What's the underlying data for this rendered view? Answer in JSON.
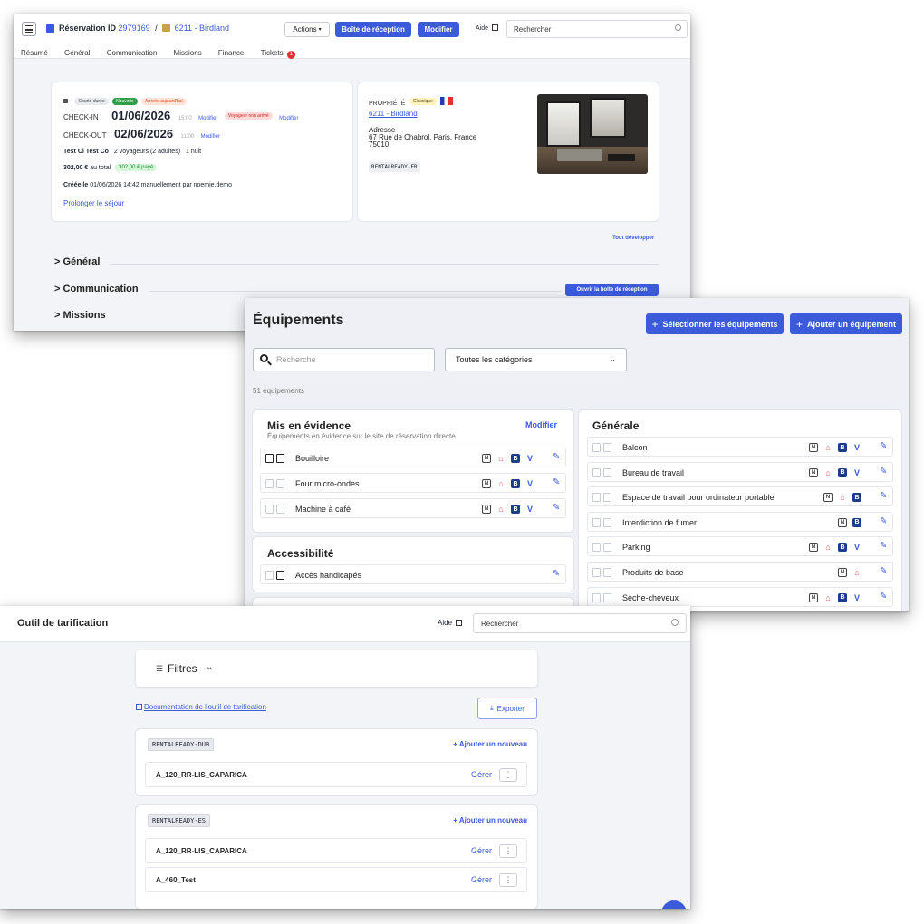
{
  "reservation": {
    "header": {
      "id_label": "Réservation ID",
      "id_value": "2979169",
      "separator": "/",
      "property_name": "6211 - Birdland",
      "actions_label": "Actions",
      "inbox_label": "Boîte de réception",
      "modify_label": "Modifier",
      "help_label": "Aide",
      "search_placeholder": "Rechercher"
    },
    "tabs": [
      {
        "label": "Résumé"
      },
      {
        "label": "Général"
      },
      {
        "label": "Communication"
      },
      {
        "label": "Missions"
      },
      {
        "label": "Finance"
      },
      {
        "label": "Tickets",
        "badge": "1"
      }
    ],
    "summary": {
      "badge_short": "Courte durée",
      "badge_new": "Nouvelle",
      "badge_arrival": "Arrivée aujourd'hui",
      "checkin_label": "CHECK-IN",
      "checkin_date": "01/06/2026",
      "checkin_time": "15:00",
      "modify_link": "Modifier",
      "guest_status": "Voyageur non arrivé",
      "checkout_label": "CHECK-OUT",
      "checkout_date": "02/06/2026",
      "checkout_time": "11:00",
      "guest_name": "Test Ci Test Co",
      "guests": "2 voyageurs (2 adultes)",
      "nights": "1 nuit",
      "total": "302,00 €",
      "total_suffix": "au total",
      "paid": "302,00 € payé",
      "created_label": "Créée le",
      "created_text": "01/06/2026 14:42 manuellement par noemie.demo",
      "extend_link": "Prolonger le séjour"
    },
    "property": {
      "label": "PROPRIÉTÉ",
      "badge": "Classique",
      "name": "6211 - Birdland",
      "address_label": "Adresse",
      "address_line1": "67 Rue de Chabrol, Paris, France",
      "address_line2": "75010",
      "tag": "RENTALREADY-FR"
    },
    "expand_all": "Tout développer",
    "sections": [
      {
        "label": "Général"
      },
      {
        "label": "Communication"
      },
      {
        "label": "Missions"
      }
    ],
    "open_inbox": "Ouvrir la boîte de réception"
  },
  "amenities": {
    "title": "Équipements",
    "select_button": "Sélectionner les équipements",
    "add_button": "Ajouter un équipement",
    "search_placeholder": "Recherche",
    "category_select": "Toutes les catégories",
    "count": "51 équipements",
    "highlighted": {
      "title": "Mis en évidence",
      "subtitle": "Équipements en évidence sur le site de réservation directe",
      "modify": "Modifier",
      "items": [
        {
          "name": "Bouilloire",
          "channels": [
            "n",
            "a",
            "b",
            "v"
          ]
        },
        {
          "name": "Four micro-ondes",
          "channels": [
            "n",
            "a",
            "b",
            "v"
          ]
        },
        {
          "name": "Machine à café",
          "channels": [
            "n",
            "a",
            "b",
            "v"
          ]
        }
      ]
    },
    "accessibility": {
      "title": "Accessibilité",
      "items": [
        {
          "name": "Accès handicapés",
          "channels": []
        }
      ]
    },
    "general": {
      "title": "Générale",
      "items": [
        {
          "name": "Balcon",
          "channels": [
            "n",
            "a",
            "b",
            "v"
          ]
        },
        {
          "name": "Bureau de travail",
          "channels": [
            "n",
            "a",
            "b",
            "v"
          ]
        },
        {
          "name": "Espace de travail pour ordinateur portable",
          "channels": [
            "n",
            "a",
            "b"
          ]
        },
        {
          "name": "Interdiction de fumer",
          "channels": [
            "n",
            "b"
          ]
        },
        {
          "name": "Parking",
          "channels": [
            "n",
            "a",
            "b",
            "v"
          ]
        },
        {
          "name": "Produits de base",
          "channels": [
            "n",
            "a"
          ]
        },
        {
          "name": "Sèche-cheveux",
          "channels": [
            "n",
            "a",
            "b",
            "v"
          ]
        }
      ]
    }
  },
  "pricing": {
    "title": "Outil de tarification",
    "help_label": "Aide",
    "search_placeholder": "Rechercher",
    "filters_label": "Filtres",
    "doc_link": "Documentation de l'outil de tarification",
    "export_label": "Exporter",
    "groups": [
      {
        "tag": "RENTALREADY-DUB",
        "add": "+ Ajouter un nouveau",
        "rows": [
          {
            "name": "A_120_RR-LIS_CAPARICA",
            "action": "Gérer"
          }
        ]
      },
      {
        "tag": "RENTALREADY-ES",
        "add": "+ Ajouter un nouveau",
        "rows": [
          {
            "name": "A_120_RR-LIS_CAPARICA",
            "action": "Gérer"
          },
          {
            "name": "A_460_Test",
            "action": "Gérer"
          }
        ]
      }
    ]
  },
  "colors": {
    "accent": "#3b5bdb",
    "airbnb": "#e8505b",
    "booking": "#1d3c8a",
    "badge_red": "#e03131"
  }
}
